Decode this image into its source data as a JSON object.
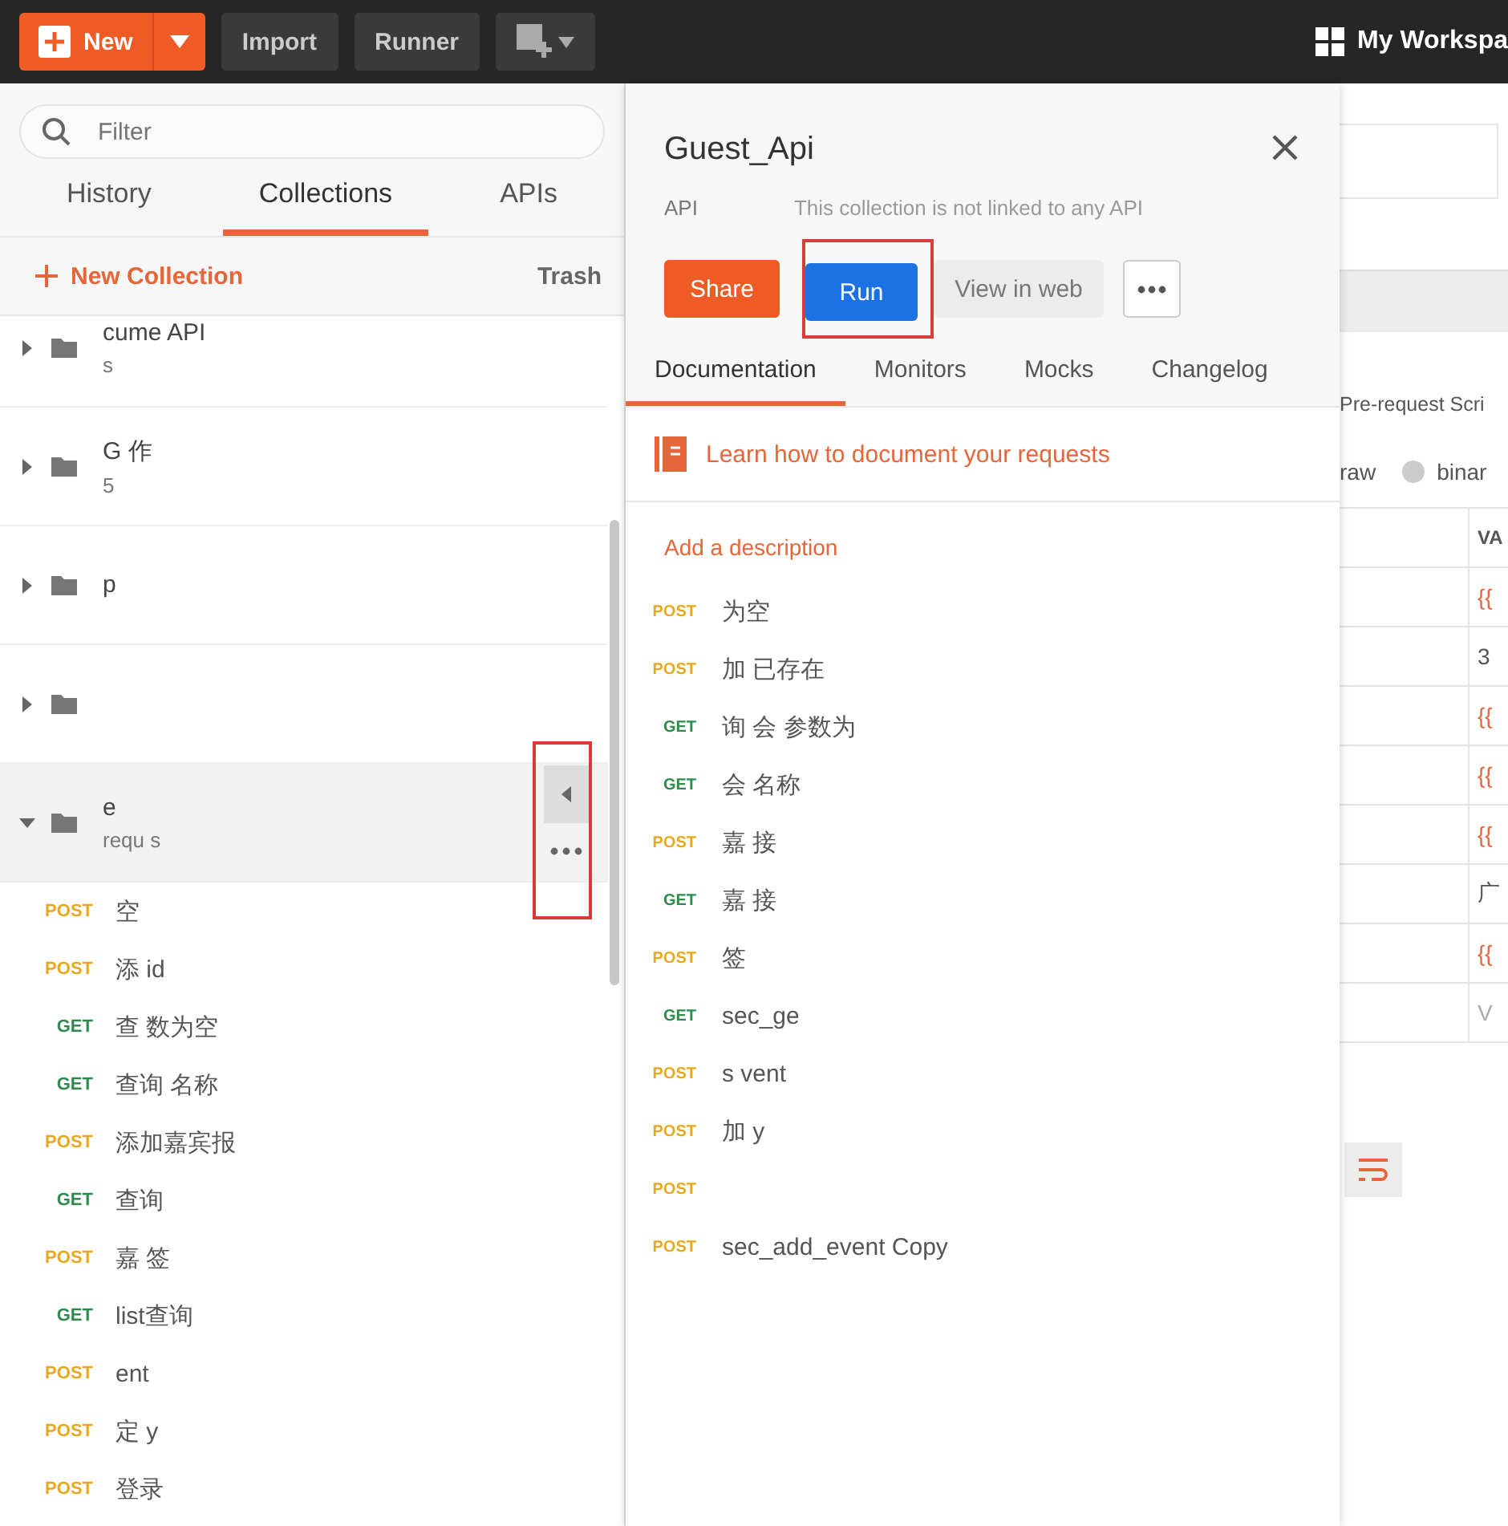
{
  "topbar": {
    "new_label": "New",
    "buttons": [
      "Import",
      "Runner"
    ],
    "workspace": "My Workspa"
  },
  "sidebar": {
    "filter_placeholder": "Filter",
    "tabs": [
      {
        "label": "History",
        "selected": false
      },
      {
        "label": "Collections",
        "selected": true
      },
      {
        "label": "APIs",
        "selected": false
      }
    ],
    "new_collection": "New Collection",
    "trash": "Trash",
    "collections": [
      {
        "name": "cume API",
        "subtitle": "s",
        "expanded": false
      },
      {
        "name": "G 作",
        "subtitle": "5",
        "expanded": false
      },
      {
        "name": "p",
        "expanded": false
      },
      {
        "expanded": false
      },
      {
        "name": "e",
        "subtitle": "requ s",
        "expanded": true
      }
    ],
    "requests": [
      {
        "method": "POST",
        "kind": "post",
        "name": "空"
      },
      {
        "method": "POST",
        "kind": "post",
        "name": "添 id"
      },
      {
        "method": "GET",
        "kind": "get",
        "name": "查 数为空"
      },
      {
        "method": "GET",
        "kind": "get",
        "name": "查询 名称"
      },
      {
        "method": "POST",
        "kind": "post",
        "name": "添加嘉宾报"
      },
      {
        "method": "GET",
        "kind": "get",
        "name": "查询"
      },
      {
        "method": "POST",
        "kind": "post",
        "name": "嘉 签"
      },
      {
        "method": "GET",
        "kind": "get",
        "name": "list查询"
      },
      {
        "method": "POST",
        "kind": "post",
        "name": "ent"
      },
      {
        "method": "POST",
        "kind": "post",
        "name": "定 y"
      },
      {
        "method": "POST",
        "kind": "post",
        "name": "登录"
      }
    ]
  },
  "panel": {
    "title": "Guest_Api",
    "api_label": "API",
    "api_note": "This collection is not linked to any API",
    "buttons": {
      "share": "Share",
      "run": "Run",
      "view": "View in web"
    },
    "tabs": [
      {
        "label": "Documentation",
        "selected": true
      },
      {
        "label": "Monitors",
        "selected": false
      },
      {
        "label": "Mocks",
        "selected": false
      },
      {
        "label": "Changelog",
        "selected": false
      }
    ],
    "learn": "Learn how to document your requests",
    "add_description": "Add a description",
    "requests": [
      {
        "method": "POST",
        "kind": "post",
        "name": "为空"
      },
      {
        "method": "POST",
        "kind": "post",
        "name": "加 已存在"
      },
      {
        "method": "GET",
        "kind": "get",
        "name": "询 会 参数为"
      },
      {
        "method": "GET",
        "kind": "get",
        "name": "会 名称"
      },
      {
        "method": "POST",
        "kind": "post",
        "name": "嘉 接"
      },
      {
        "method": "GET",
        "kind": "get",
        "name": "嘉 接"
      },
      {
        "method": "POST",
        "kind": "post",
        "name": "签"
      },
      {
        "method": "GET",
        "kind": "get",
        "name": "sec_ge"
      },
      {
        "method": "POST",
        "kind": "post",
        "name": "s vent"
      },
      {
        "method": "POST",
        "kind": "post",
        "name": "加 y"
      },
      {
        "method": "POST",
        "kind": "post"
      },
      {
        "method": "POST",
        "kind": "post",
        "name": "sec_add_event Copy"
      }
    ]
  },
  "background": {
    "tab_text": "Pre-request Scri",
    "body_options": [
      {
        "label": "raw"
      },
      {
        "label": "binar",
        "selected": false
      }
    ],
    "column": "VA",
    "values": [
      {
        "text": "{{",
        "kind": "var"
      },
      {
        "text": "3",
        "kind": "plain"
      },
      {
        "text": "{{",
        "kind": "var"
      },
      {
        "text": "{{",
        "kind": "var"
      },
      {
        "text": "{{",
        "kind": "var"
      },
      {
        "text": "广",
        "kind": "plain"
      },
      {
        "text": "{{",
        "kind": "var"
      },
      {
        "text": "V",
        "kind": "placeholder"
      }
    ]
  }
}
